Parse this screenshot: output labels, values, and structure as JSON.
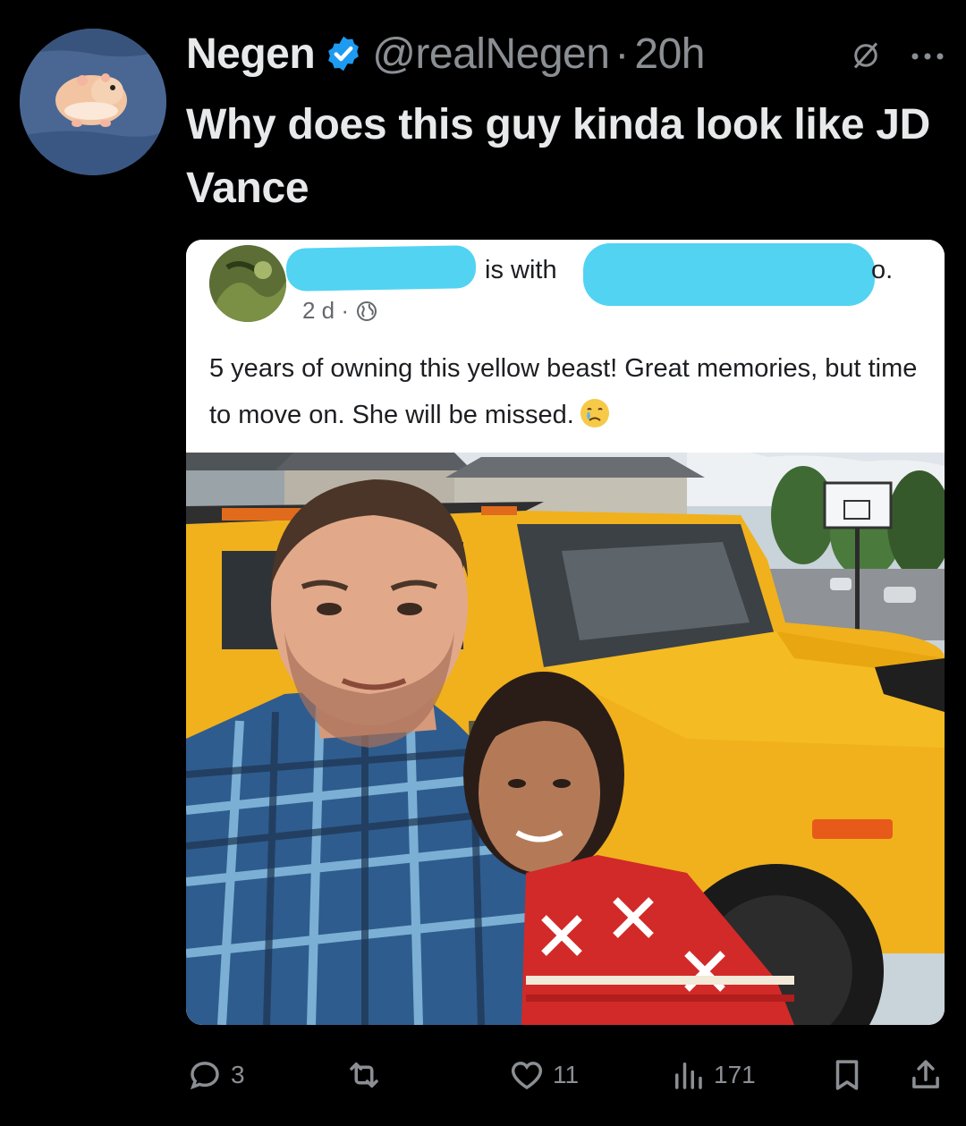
{
  "tweet": {
    "author_name": "Negen",
    "handle": "@realNegen",
    "separator": "·",
    "time": "20h",
    "text": "Why does this guy kinda look like JD Vance"
  },
  "embedded_post": {
    "is_with": "is with",
    "tag_tail": "o.",
    "meta_time": "2 d ·",
    "caption": "5 years of owning this yellow beast!  Great memories, but time to move on.  She will be missed."
  },
  "actions": {
    "replies": "3",
    "reposts": "",
    "likes": "11",
    "views": "171"
  },
  "colors": {
    "background": "#000000",
    "verified": "#1d9bf0",
    "redaction": "#52d3f2",
    "vehicle": "#f2b41c"
  },
  "icons": [
    "verified-badge-icon",
    "grok-icon",
    "more-icon",
    "globe-icon",
    "crying-face-icon",
    "reply-icon",
    "repost-icon",
    "like-icon",
    "views-icon",
    "bookmark-icon",
    "share-icon"
  ]
}
